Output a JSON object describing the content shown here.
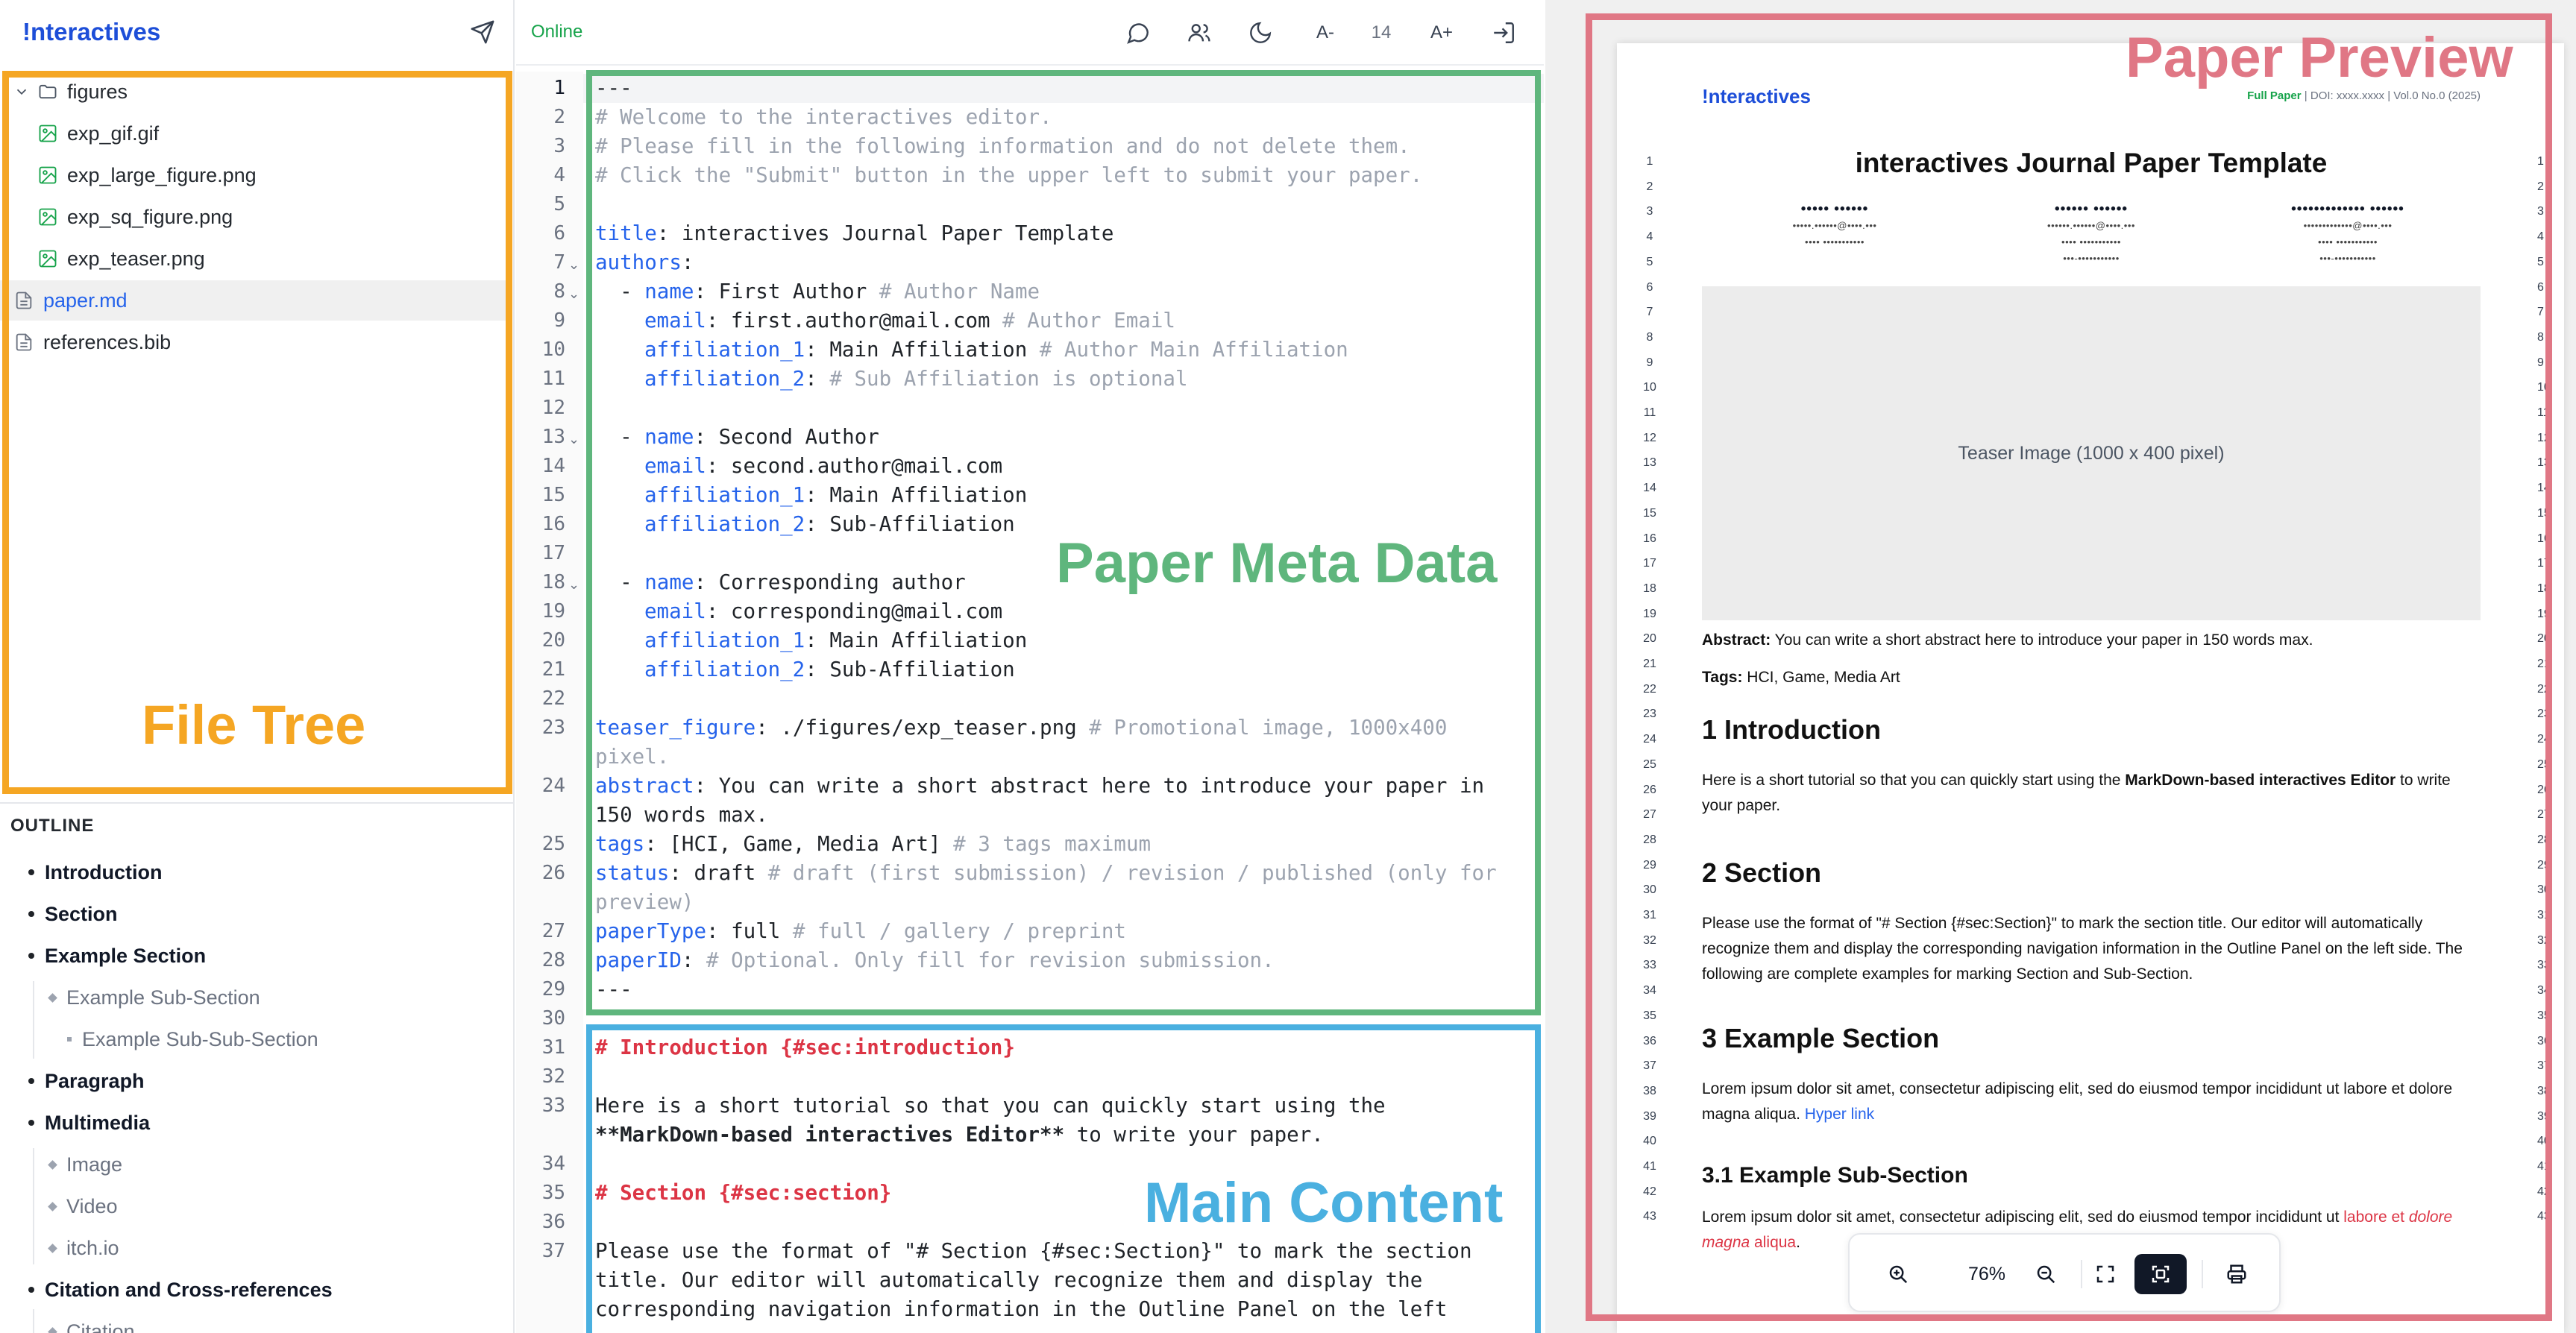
{
  "sidebar": {
    "brand": "!nteractives",
    "tree": [
      {
        "label": "figures",
        "kind": "folder"
      },
      {
        "label": "exp_gif.gif",
        "kind": "image"
      },
      {
        "label": "exp_large_figure.png",
        "kind": "image"
      },
      {
        "label": "exp_sq_figure.png",
        "kind": "image"
      },
      {
        "label": "exp_teaser.png",
        "kind": "image"
      },
      {
        "label": "paper.md",
        "kind": "doc",
        "active": true
      },
      {
        "label": "references.bib",
        "kind": "doc"
      }
    ],
    "outline_title": "OUTLINE",
    "outline": [
      {
        "label": "Introduction",
        "level": 1
      },
      {
        "label": "Section",
        "level": 1
      },
      {
        "label": "Example Section",
        "level": 1
      },
      {
        "label": "Example Sub-Section",
        "level": 2
      },
      {
        "label": "Example Sub-Sub-Section",
        "level": 3
      },
      {
        "label": "Paragraph",
        "level": 1
      },
      {
        "label": "Multimedia",
        "level": 1
      },
      {
        "label": "Image",
        "level": 2
      },
      {
        "label": "Video",
        "level": 2
      },
      {
        "label": "itch.io",
        "level": 2
      },
      {
        "label": "Citation and Cross-references",
        "level": 1
      },
      {
        "label": "Citation",
        "level": 2
      }
    ]
  },
  "toolbar": {
    "status": "Online",
    "font_decrease": "A-",
    "font_size": "14",
    "font_increase": "A+",
    "icons": [
      "comment-icon",
      "users-icon",
      "moon-icon",
      "export-icon"
    ]
  },
  "editor": {
    "line_numbers": [
      "1",
      "2",
      "3",
      "4",
      "5",
      "6",
      "7",
      "8",
      "9",
      "10",
      "11",
      "12",
      "13",
      "14",
      "15",
      "16",
      "17",
      "18",
      "19",
      "20",
      "21",
      "22",
      "23",
      "24",
      "25",
      "26",
      "27",
      "28",
      "29",
      "30",
      "31",
      "32",
      "33",
      "34",
      "35",
      "36",
      "37"
    ],
    "lines": {
      "l1": "---",
      "l2": "# Welcome to the interactives editor.",
      "l3": "# Please fill in the following information and do not delete them.",
      "l4": "# Click the \"Submit\" button in the upper left to submit your paper.",
      "l6k": "title",
      "l6v": ": interactives Journal Paper Template",
      "l7k": "authors",
      "l7v": ":",
      "l8a": "  - ",
      "l8k": "name",
      "l8v": ": First Author ",
      "l8c": "# Author Name",
      "l9k": "email",
      "l9v": ": first.author@mail.com ",
      "l9c": "# Author Email",
      "l10k": "affiliation_1",
      "l10v": ": Main Affiliation ",
      "l10c": "# Author Main Affiliation",
      "l11k": "affiliation_2",
      "l11v": ": ",
      "l11c": "# Sub Affiliation is optional",
      "l13a": "  - ",
      "l13k": "name",
      "l13v": ": Second Author",
      "l14k": "email",
      "l14v": ": second.author@mail.com",
      "l15k": "affiliation_1",
      "l15v": ": Main Affiliation",
      "l16k": "affiliation_2",
      "l16v": ": Sub-Affiliation",
      "l18a": "  - ",
      "l18k": "name",
      "l18v": ": Corresponding author",
      "l19k": "email",
      "l19v": ": corresponding@mail.com",
      "l20k": "affiliation_1",
      "l20v": ": Main Affiliation",
      "l21k": "affiliation_2",
      "l21v": ": Sub-Affiliation",
      "l23k": "teaser_figure",
      "l23v": ": ./figures/exp_teaser.png ",
      "l23c": "# Promotional image, 1000x400 pixel.",
      "l24k": "abstract",
      "l24v": ": You can write a short abstract here to introduce your paper in 150 words max.",
      "l25k": "tags",
      "l25v": ": [HCI, Game, Media Art] ",
      "l25c": "# 3 tags maximum",
      "l26k": "status",
      "l26v": ": draft ",
      "l26c": "# draft (first submission) / revision / published (only for preview)",
      "l27k": "paperType",
      "l27v": ": full ",
      "l27c": "# full / gallery / preprint",
      "l28k": "paperID",
      "l28v": ": ",
      "l28c": "# Optional. Only fill for revision submission.",
      "l29": "---",
      "l31": "# Introduction {#sec:introduction}",
      "l33a": "Here is a short tutorial so that you can quickly start using the",
      "l33b": "**MarkDown-based interactives Editor**",
      "l33c": " to write your paper.",
      "l35": "# Section {#sec:section}",
      "l37": "Please use the format of \"# Section {#sec:Section}\" to mark the section title. Our editor will automatically recognize them and display the corresponding navigation information in the Outline Panel on the left"
    }
  },
  "preview": {
    "brand": "!nteractives",
    "meta_type": "Full Paper",
    "meta_rest": " | DOI: xxxx.xxxx | Vol.0 No.0 (2025)",
    "title": "interactives Journal Paper Template",
    "authors": [
      {
        "name": "••••• ••••••",
        "line1": "•••••.••••••@••••.•••",
        "line2": "•••• •••••••••••"
      },
      {
        "name": "•••••• ••••••",
        "line1": "••••••.••••••@••••.•••",
        "line2": "•••• •••••••••••"
      },
      {
        "name": "••••••••••••• ••••••",
        "line1": "•••••••••••••@••••.•••",
        "line2": "•••• •••••••••••"
      }
    ],
    "author_extra": "•••-•••••••••••",
    "teaser": "Teaser Image (1000 x 400 pixel)",
    "abstract_label": "Abstract:",
    "abstract_text": " You can write a short abstract here to introduce your paper in 150 words max.",
    "tags_label": "Tags:",
    "tags_text": " HCI, Game, Media Art",
    "h_intro": "1 Introduction",
    "intro_a": "Here is a short tutorial so that you can quickly start using the ",
    "intro_b": "MarkDown-based interactives Editor",
    "intro_c": " to write your paper.",
    "h_section": "2 Section",
    "section_text": "Please use the format of \"# Section {#sec:Section}\" to mark the section title. Our editor will automatically recognize them and display the corresponding navigation information in the Outline Panel on the left side. The following are complete examples for marking Section and Sub-Section.",
    "h_example": "3 Example Section",
    "example_text": "Lorem ipsum dolor sit amet, consectetur adipiscing elit, sed do eiusmod tempor incididunt ut labore et dolore magna aliqua. ",
    "example_link": "Hyper link",
    "h_sub": "3.1 Example Sub-Section",
    "sub_a": "Lorem ipsum dolor sit amet, consectetur adipiscing elit, sed do eiusmod tempor incididunt ut ",
    "sub_b": "labore et ",
    "sub_c": "dolore magna",
    "sub_d": " aliqua",
    "sub_e": ".",
    "line_numbers": [
      "1",
      "2",
      "3",
      "4",
      "5",
      "6",
      "7",
      "8",
      "9",
      "10",
      "11",
      "12",
      "13",
      "14",
      "15",
      "16",
      "17",
      "18",
      "19",
      "20",
      "21",
      "22",
      "23",
      "24",
      "25",
      "26",
      "27",
      "28",
      "29",
      "30",
      "31",
      "32",
      "33",
      "34",
      "35",
      "36",
      "37",
      "38",
      "39",
      "40",
      "41",
      "42",
      "43"
    ],
    "zoom": "76%"
  },
  "annotations": {
    "file_tree": "File Tree",
    "meta": "Paper Meta Data",
    "main": "Main Content",
    "preview": "Paper Preview"
  },
  "colors": {
    "brand": "#1d4ed8",
    "online": "#16a34a",
    "file_tree_box": "#f5a623",
    "meta_box": "#5fb67d",
    "main_box": "#4ab0e0",
    "preview_box": "#e07785"
  }
}
